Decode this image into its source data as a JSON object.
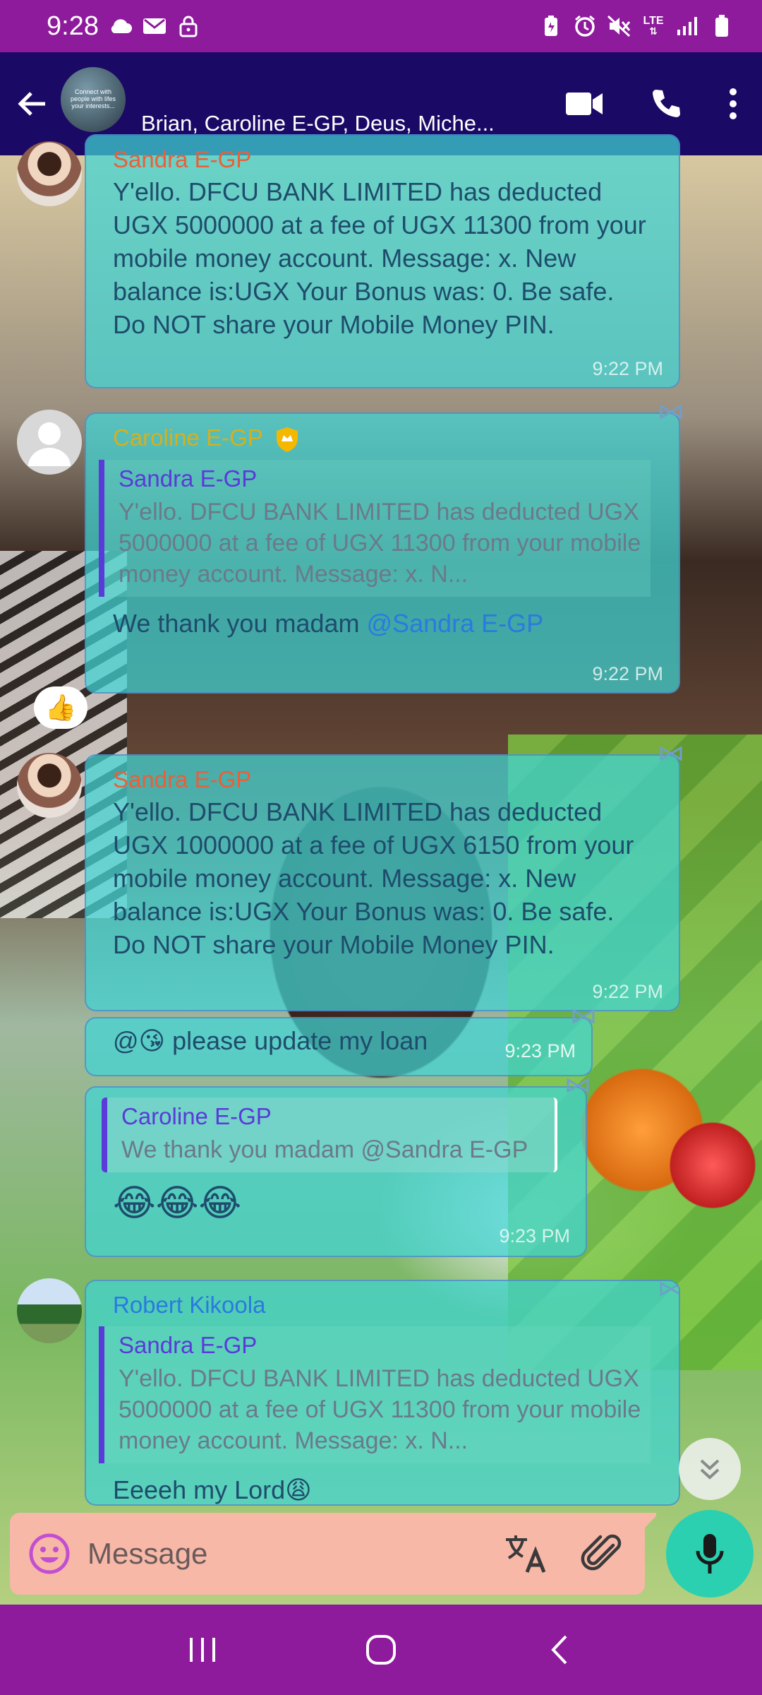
{
  "status_bar": {
    "time": "9:28",
    "left_icons": [
      "cloud-icon",
      "mail-icon",
      "lock-icon"
    ],
    "right_icons": [
      "battery-saver-icon",
      "alarm-icon",
      "mute-icon",
      "lte-icon",
      "signal-icon",
      "battery-icon"
    ],
    "network_label": "LTE"
  },
  "header": {
    "title": "Brian, Caroline E-GP, Deus, Miche...",
    "avatar_text": "Connect with people with lifes your interests...",
    "icons": [
      "back-arrow-icon",
      "video-call-icon",
      "phone-icon",
      "more-vert-icon"
    ]
  },
  "messages": [
    {
      "sender": "Sandra E-GP",
      "text": "Y'ello. DFCU BANK LIMITED  has deducted UGX 5000000 at a fee of UGX 11300 from your mobile money account. Message: x. New balance is:UGX Your Bonus was: 0. Be safe. Do NOT share your Mobile Money PIN.",
      "time": "9:22 PM"
    },
    {
      "sender": "Caroline E-GP",
      "quote_sender": "Sandra E-GP",
      "quote_text": "Y'ello. DFCU BANK LIMITED  has deducted UGX 5000000 at a fee of UGX 11300 from your mobile money account. Message: x. N...",
      "text": "We thank you madam ",
      "mention": "@Sandra E-GP",
      "time": "9:22 PM",
      "reaction": "👍"
    },
    {
      "sender": "Sandra E-GP",
      "text": "Y'ello. DFCU BANK LIMITED  has deducted UGX 1000000 at a fee of UGX 6150 from your mobile money account. Message: x. New balance is:UGX Your Bonus was: 0. Be safe. Do NOT share your Mobile Money PIN.",
      "time": "9:22 PM"
    },
    {
      "text": "@😘 please update my loan",
      "time": "9:23 PM"
    },
    {
      "quote_sender": "Caroline E-GP",
      "quote_text": "We thank you madam @Sandra E-GP",
      "text": "😂😂😂",
      "time": "9:23 PM"
    },
    {
      "sender": "Robert Kikoola",
      "quote_sender": "Sandra E-GP",
      "quote_text": "Y'ello. DFCU BANK LIMITED  has deducted UGX 5000000 at a fee of UGX 11300 from your mobile money account. Message: x. N...",
      "text": "Eeeeh my Lord😩"
    }
  ],
  "composer": {
    "placeholder": "Message"
  },
  "colors": {
    "status_bar": "#8e1a9c",
    "header": "#1a0a66",
    "bubble": "#40d6d6",
    "sandra": "#e8603a",
    "caroline": "#d4b020",
    "robert": "#2a7ae0",
    "mic": "#2ad0b0",
    "composer": "#f7b8a8"
  }
}
